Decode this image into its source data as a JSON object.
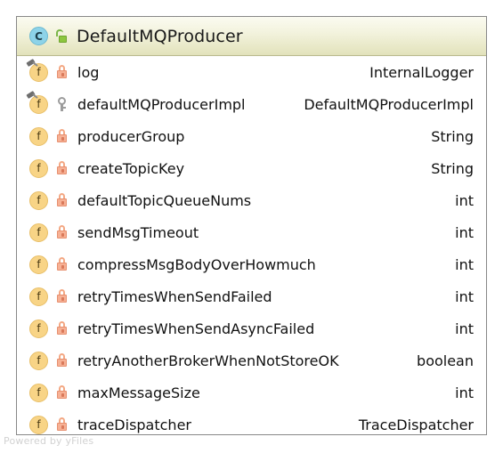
{
  "diagram": {
    "kind": "uml-class",
    "colors": {
      "header_gradient_top": "#fbfbf1",
      "header_gradient_bottom": "#e2e2bb",
      "card_border": "#888888",
      "field_badge": "#f8d486",
      "class_badge": "#8dd3e8",
      "lock_private": "#f7b195",
      "key_protected": "#9c9c9c",
      "unlock_public": "#8cc63e",
      "watermark": "#d2d2d2"
    },
    "header": {
      "class_badge_letter": "C",
      "class_badge_icon": "class-circle-icon",
      "visibility_icon": "unlock-public-icon",
      "title": "DefaultMQProducer"
    },
    "members": [
      {
        "member_icon": "field-static-icon",
        "visibility_icon": "lock-private-icon",
        "visibility": "private",
        "static": true,
        "name": "log",
        "type": "InternalLogger"
      },
      {
        "member_icon": "field-static-icon",
        "visibility_icon": "key-protected-icon",
        "visibility": "protected",
        "static": true,
        "name": "defaultMQProducerImpl",
        "type": "DefaultMQProducerImpl"
      },
      {
        "member_icon": "field-icon",
        "visibility_icon": "lock-private-icon",
        "visibility": "private",
        "static": false,
        "name": "producerGroup",
        "type": "String"
      },
      {
        "member_icon": "field-icon",
        "visibility_icon": "lock-private-icon",
        "visibility": "private",
        "static": false,
        "name": "createTopicKey",
        "type": "String"
      },
      {
        "member_icon": "field-icon",
        "visibility_icon": "lock-private-icon",
        "visibility": "private",
        "static": false,
        "name": "defaultTopicQueueNums",
        "type": "int"
      },
      {
        "member_icon": "field-icon",
        "visibility_icon": "lock-private-icon",
        "visibility": "private",
        "static": false,
        "name": "sendMsgTimeout",
        "type": "int"
      },
      {
        "member_icon": "field-icon",
        "visibility_icon": "lock-private-icon",
        "visibility": "private",
        "static": false,
        "name": "compressMsgBodyOverHowmuch",
        "type": "int"
      },
      {
        "member_icon": "field-icon",
        "visibility_icon": "lock-private-icon",
        "visibility": "private",
        "static": false,
        "name": "retryTimesWhenSendFailed",
        "type": "int"
      },
      {
        "member_icon": "field-icon",
        "visibility_icon": "lock-private-icon",
        "visibility": "private",
        "static": false,
        "name": "retryTimesWhenSendAsyncFailed",
        "type": "int"
      },
      {
        "member_icon": "field-icon",
        "visibility_icon": "lock-private-icon",
        "visibility": "private",
        "static": false,
        "name": "retryAnotherBrokerWhenNotStoreOK",
        "type": "boolean"
      },
      {
        "member_icon": "field-icon",
        "visibility_icon": "lock-private-icon",
        "visibility": "private",
        "static": false,
        "name": "maxMessageSize",
        "type": "int"
      },
      {
        "member_icon": "field-icon",
        "visibility_icon": "lock-private-icon",
        "visibility": "private",
        "static": false,
        "name": "traceDispatcher",
        "type": "TraceDispatcher"
      }
    ],
    "watermark": "Powered by yFiles"
  }
}
